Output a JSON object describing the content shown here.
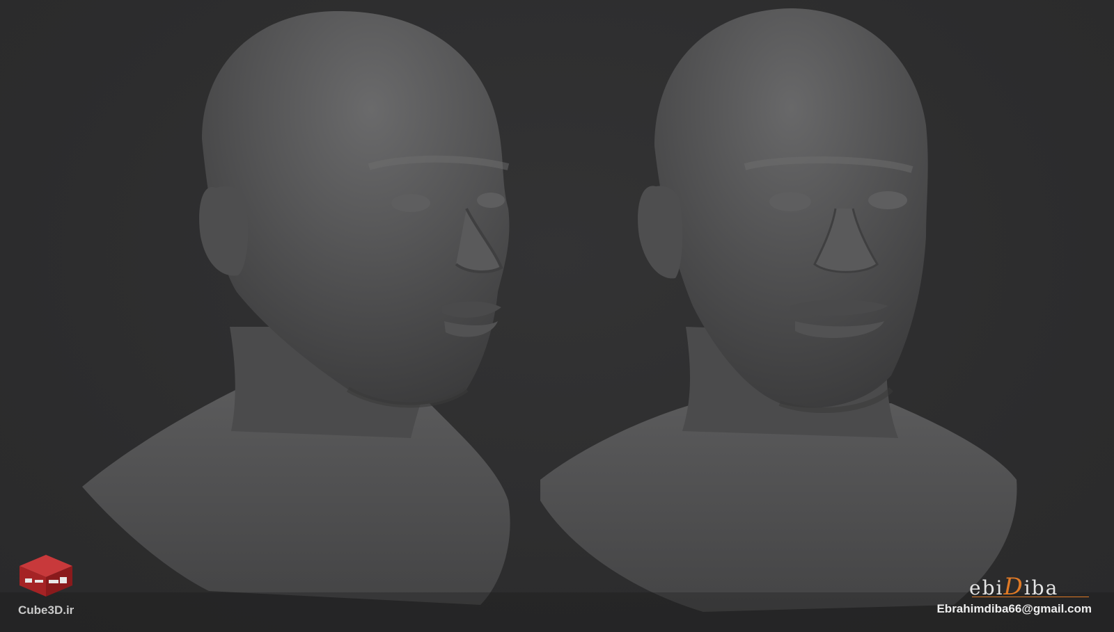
{
  "image": {
    "subject": "two-grey-clay-sculpt-busts",
    "background_color": "#2e2e2f"
  },
  "left_watermark": {
    "logo_icon": "cube3d-logo",
    "logo_color": "#b8282a",
    "site": "Cube3D.ir"
  },
  "right_signature": {
    "brand_prefix": "ebi",
    "brand_accent": "D",
    "brand_suffix": "iba",
    "accent_color": "#e07a26",
    "email": "Ebrahimdiba66@gmail.com"
  }
}
